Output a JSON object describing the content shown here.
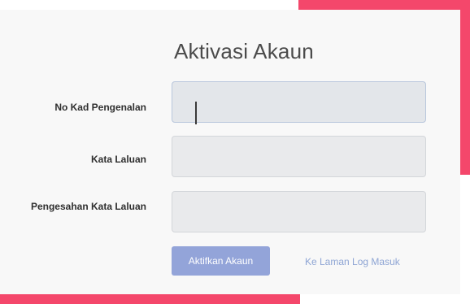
{
  "form": {
    "title": "Aktivasi Akaun",
    "fields": [
      {
        "label": "No Kad Pengenalan",
        "value": "",
        "placeholder": "",
        "focused": true
      },
      {
        "label": "Kata Laluan",
        "value": "",
        "placeholder": ""
      },
      {
        "label": "Pengesahan Kata Laluan",
        "value": "",
        "placeholder": ""
      }
    ],
    "submit_label": "Aktifkan Akaun",
    "login_link_label": "Ke Laman Log Masuk"
  },
  "colors": {
    "frame_accent": "#f4476b",
    "button": "#93a4d9",
    "link": "#8ea5d4",
    "field_bg": "#e9eaec"
  }
}
